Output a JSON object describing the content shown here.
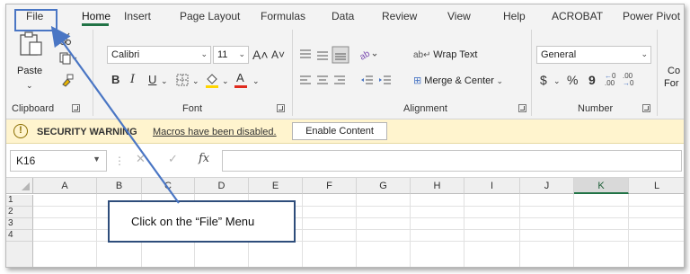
{
  "tabs": [
    {
      "label": "File"
    },
    {
      "label": "Home"
    },
    {
      "label": "Insert"
    },
    {
      "label": "Page Layout"
    },
    {
      "label": "Formulas"
    },
    {
      "label": "Data"
    },
    {
      "label": "Review"
    },
    {
      "label": "View"
    },
    {
      "label": "Help"
    },
    {
      "label": "ACROBAT"
    },
    {
      "label": "Power Pivot"
    }
  ],
  "active_tab": "Home",
  "ribbon": {
    "clipboard": {
      "paste_label": "Paste",
      "group_label": "Clipboard"
    },
    "font": {
      "font_name": "Calibri",
      "font_size": "11",
      "bold": "B",
      "italic": "I",
      "underline": "U",
      "grow": "A˄",
      "shrink": "A˅",
      "font_color_glyph": "A",
      "group_label": "Font"
    },
    "alignment": {
      "wrap_text": "Wrap Text",
      "merge_center": "Merge & Center",
      "group_label": "Alignment"
    },
    "number": {
      "format": "General",
      "currency": "$",
      "percent": "%",
      "comma": "9",
      "inc_decimal": ".00",
      "dec_decimal": ".00",
      "group_label": "Number"
    },
    "styles": {
      "partial_1": "Co",
      "partial_2": "For"
    }
  },
  "security_bar": {
    "icon": "warning-icon",
    "title": "SECURITY WARNING",
    "message": "Macros have been disabled.",
    "button": "Enable Content"
  },
  "formula_bar": {
    "name_box": "K16",
    "fx": "fx",
    "value": ""
  },
  "grid": {
    "columns": [
      "A",
      "B",
      "C",
      "D",
      "E",
      "F",
      "G",
      "H",
      "I",
      "J",
      "K",
      "L"
    ],
    "selected_column": "K",
    "rows": [
      "1",
      "2",
      "3",
      "4"
    ]
  },
  "annotation": {
    "callout_text": "Click on the “File” Menu"
  },
  "colors": {
    "accent_green": "#217346",
    "annotation_blue": "#4a76c4",
    "warning_bg": "#fff4ce"
  }
}
